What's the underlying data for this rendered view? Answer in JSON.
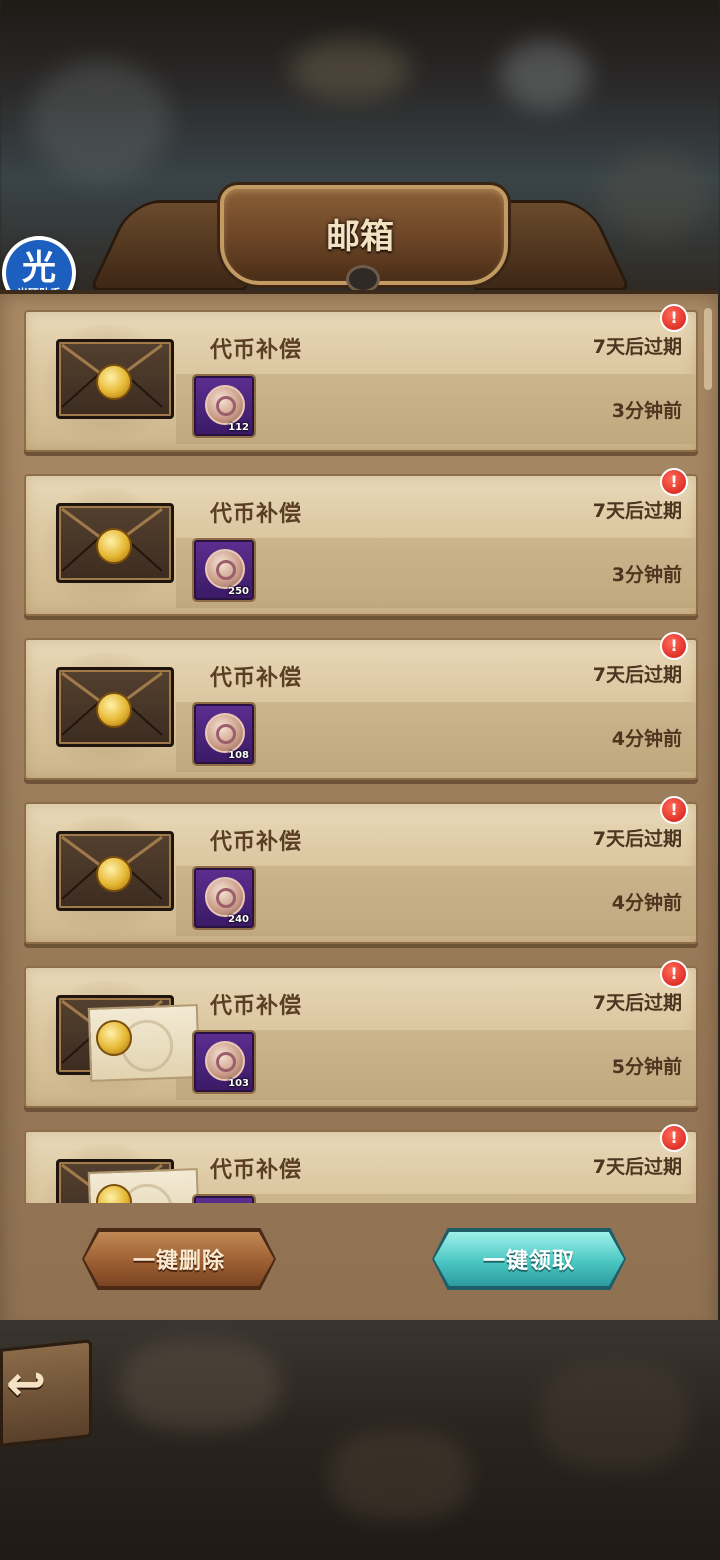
{
  "header": {
    "title": "邮箱"
  },
  "badge": {
    "big": "光",
    "small": "光环助手"
  },
  "mails": [
    {
      "subject": "代币补偿",
      "expire": "7天后过期",
      "time": "3分钟前",
      "qty": "112",
      "opened": false,
      "alert": "!"
    },
    {
      "subject": "代币补偿",
      "expire": "7天后过期",
      "time": "3分钟前",
      "qty": "250",
      "opened": false,
      "alert": "!"
    },
    {
      "subject": "代币补偿",
      "expire": "7天后过期",
      "time": "4分钟前",
      "qty": "108",
      "opened": false,
      "alert": "!"
    },
    {
      "subject": "代币补偿",
      "expire": "7天后过期",
      "time": "4分钟前",
      "qty": "240",
      "opened": false,
      "alert": "!"
    },
    {
      "subject": "代币补偿",
      "expire": "7天后过期",
      "time": "5分钟前",
      "qty": "103",
      "opened": true,
      "alert": "!"
    },
    {
      "subject": "代币补偿",
      "expire": "7天后过期",
      "time": "",
      "qty": "",
      "opened": true,
      "alert": "!"
    }
  ],
  "footer": {
    "delete_all": "一键删除",
    "claim_all": "一键领取"
  },
  "icons": {
    "back": "back-arrow-icon",
    "mail": "envelope-icon",
    "item": "token-coin-icon",
    "alert": "exclamation-icon"
  },
  "colors": {
    "panel": "#a98a66",
    "row": "#dcc8a2",
    "claim_button": "#4bc7c3",
    "delete_button": "#9c5f32",
    "alert": "#d21a12"
  }
}
